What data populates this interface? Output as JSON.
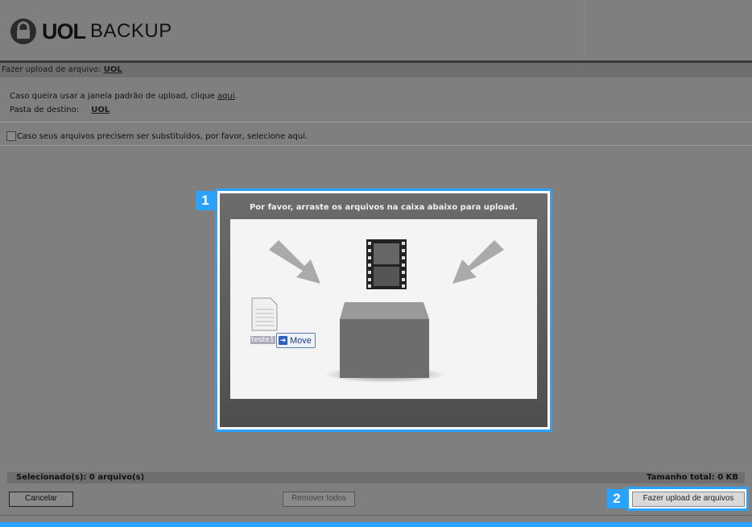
{
  "header": {
    "brand_main": "UOL",
    "brand_sub": "BACKUP"
  },
  "breadcrumb": {
    "prefix": "Fazer upload de arquivo:",
    "folder": "UOL"
  },
  "info": {
    "line1_text": "Caso queira usar a janela padrão de upload, clique",
    "line1_link": "aqui",
    "line1_end": ".",
    "dest_label": "Pasta de destino:",
    "dest_value": "UOL"
  },
  "replace_option": {
    "label": "Caso seus arquivos precisem ser substituídos, por favor, selecione aqui.",
    "checked": false
  },
  "drop_zone": {
    "title": "Por favor, arraste os arquivos na caixa abaixo para upload.",
    "file_label": "teste1",
    "move_label": "Move"
  },
  "callouts": {
    "one": "1",
    "two": "2"
  },
  "summary": {
    "selected": "Selecionado(s): 0 arquivo(s)",
    "total": "Tamanho total: 0 KB"
  },
  "buttons": {
    "cancel": "Cancelar",
    "remove_all": "Remover todos",
    "upload": "Fazer upload de arquivos"
  },
  "colors": {
    "accent": "#29a3ff",
    "overlay": "#7f7f7f"
  }
}
